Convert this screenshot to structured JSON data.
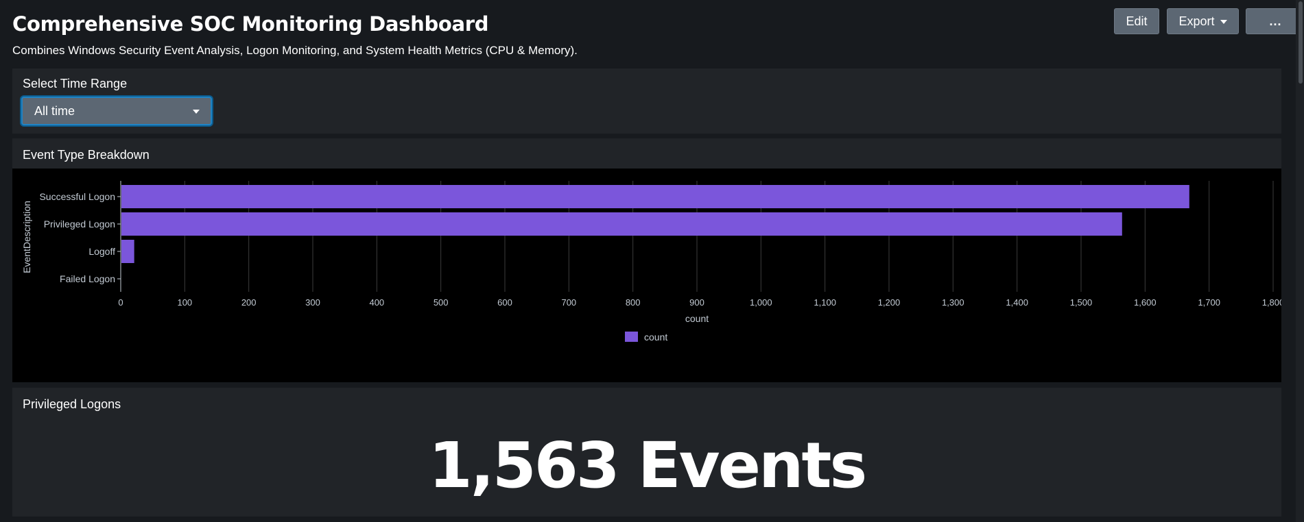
{
  "header": {
    "title": "Comprehensive SOC Monitoring Dashboard",
    "subtitle": "Combines Windows Security Event Analysis, Logon Monitoring, and System Health Metrics (CPU & Memory).",
    "edit_label": "Edit",
    "export_label": "Export",
    "more_label": "..."
  },
  "time_range": {
    "label": "Select Time Range",
    "selected": "All time"
  },
  "event_panel": {
    "title": "Event Type Breakdown"
  },
  "chart_data": {
    "type": "bar",
    "orientation": "horizontal",
    "categories": [
      "Successful Logon",
      "Privileged Logon",
      "Logoff",
      "Failed Logon"
    ],
    "series": [
      {
        "name": "count",
        "values": [
          1668,
          1563,
          20,
          0
        ]
      }
    ],
    "xlabel": "count",
    "ylabel": "EventDescription",
    "xlim": [
      0,
      1800
    ],
    "xticks": [
      "0",
      "100",
      "200",
      "300",
      "400",
      "500",
      "600",
      "700",
      "800",
      "900",
      "1,000",
      "1,100",
      "1,200",
      "1,300",
      "1,400",
      "1,500",
      "1,600",
      "1,700",
      "1,800"
    ],
    "grid": true,
    "legend": "bottom-center",
    "bar_color": "#7b56db"
  },
  "privileged_panel": {
    "title": "Privileged Logons",
    "value": "1,563 Events"
  }
}
